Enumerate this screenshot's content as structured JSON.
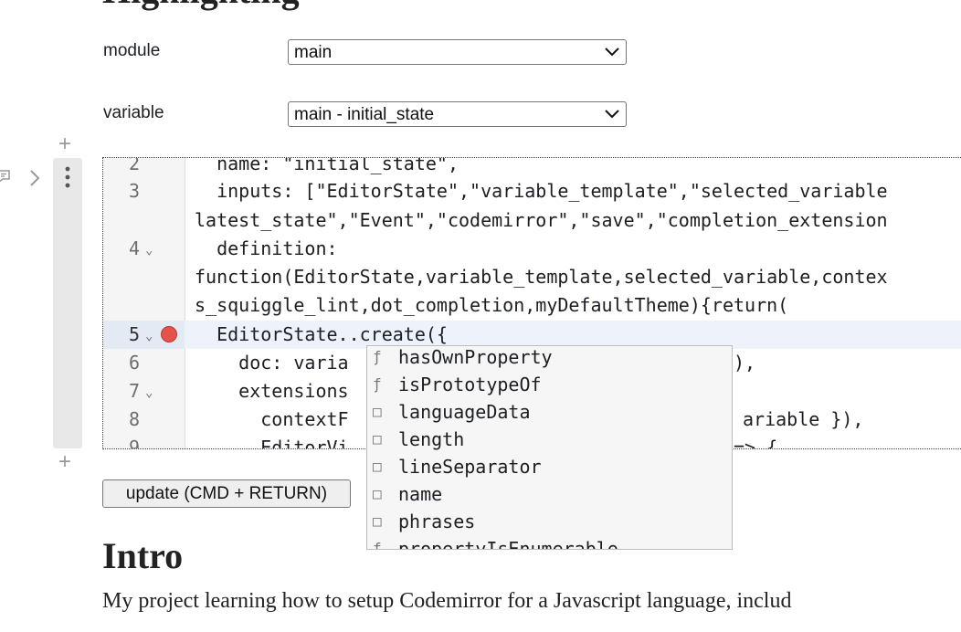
{
  "page": {
    "top_heading": "Highlighting"
  },
  "form": {
    "module_label": "module",
    "module_value": "main",
    "variable_label": "variable",
    "variable_value": "main - initial_state"
  },
  "cell": {
    "add_above": "+",
    "add_below": "+",
    "menu_icon": "kebab-icon",
    "collapse_icon": "chevron-right-icon",
    "comment_icon": "comment-icon"
  },
  "editor": {
    "lines": [
      {
        "num": "2",
        "text": "  name: \"initial_state\","
      },
      {
        "num": "3",
        "text": "  inputs: [\"EditorState\",\"variable_template\",\"selected_variable"
      },
      {
        "num": "",
        "text": "latest_state\",\"Event\",\"codemirror\",\"save\",\"completion_extension"
      },
      {
        "num": "4",
        "text": "  definition:"
      },
      {
        "num": "",
        "text": "function(EditorState,variable_template,selected_variable,contex"
      },
      {
        "num": "",
        "text": "s_squiggle_lint,dot_completion,myDefaultTheme){return("
      },
      {
        "num": "5",
        "text": "  EditorState..create({"
      },
      {
        "num": "6",
        "text": "    doc: varia"
      },
      {
        "num": "7",
        "text": "    extensions"
      },
      {
        "num": "8",
        "text": "      contextF"
      },
      {
        "num": "9",
        "text": "      EditorVi"
      }
    ],
    "line6_tail": "),",
    "line8_tail": "ariable }),",
    "line9_tail": "=> {",
    "fold_marker": "⌄"
  },
  "autocomplete": {
    "items": [
      {
        "icon": "ƒ",
        "label": "hasOwnProperty"
      },
      {
        "icon": "ƒ",
        "label": "isPrototypeOf"
      },
      {
        "icon": "□",
        "label": "languageData"
      },
      {
        "icon": "□",
        "label": "length"
      },
      {
        "icon": "□",
        "label": "lineSeparator"
      },
      {
        "icon": "□",
        "label": "name"
      },
      {
        "icon": "□",
        "label": "phrases"
      },
      {
        "icon": "ƒ",
        "label": "propertyIsEnumerable"
      }
    ]
  },
  "actions": {
    "update_label": "update (CMD + RETURN)"
  },
  "content": {
    "intro_heading": "Intro",
    "intro_text": "My project learning how to setup Codemirror for a Javascript language, includ"
  },
  "colors": {
    "breakpoint": "#e5534b",
    "keyword": "#7a2ab3",
    "string": "#a31515",
    "property": "#0b4b9c"
  }
}
